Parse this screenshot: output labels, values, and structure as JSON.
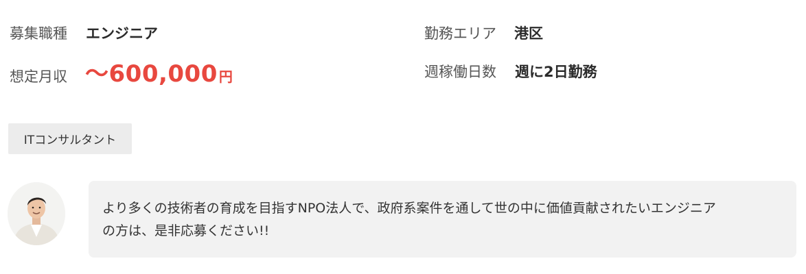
{
  "job": {
    "category_label": "募集職種",
    "category_value": "エンジニア",
    "area_label": "勤務エリア",
    "area_value": "港区",
    "salary_label": "想定月収",
    "salary_amount": "〜600,000",
    "salary_unit": "円",
    "workdays_label": "週稼働日数",
    "workdays_value": "週に2日勤務"
  },
  "tags": [
    "ITコンサルタント"
  ],
  "message": {
    "avatar_icon": "person-photo",
    "line1": "より多くの技術者の育成を目指すNPO法人で、政府系案件を通して世の中に価値貢献されたいエンジニア",
    "line2": "の方は、是非応募ください!!"
  },
  "colors": {
    "accent": "#e8483f",
    "tag_bg": "#ececec",
    "bubble_bg": "#f2f2f2"
  }
}
